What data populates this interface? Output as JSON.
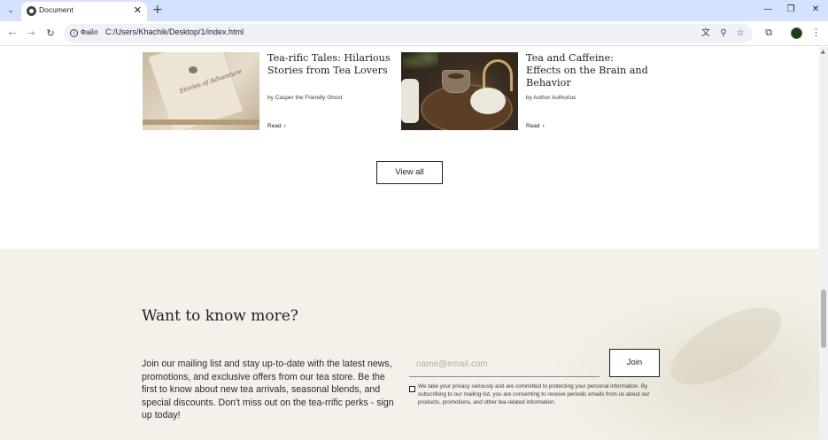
{
  "browser": {
    "tab_title": "Document",
    "site_label": "Файл",
    "url": "C:/Users/Khachik/Desktop/1/index.html",
    "icons": [
      "tab-search-icon",
      "globe-icon",
      "close-icon",
      "plus-icon",
      "minimize-icon",
      "restore-icon",
      "window-close-icon",
      "back-icon",
      "forward-icon",
      "reload-icon",
      "info-icon",
      "translate-icon",
      "zoom-icon",
      "star-icon",
      "extensions-icon",
      "profile-icon",
      "menu-icon"
    ]
  },
  "articles": [
    {
      "title": "Tea-rific Tales: Hilarious Stories from Tea Lovers",
      "author": "by Casper the Friendly Ghost",
      "read_label": "Read",
      "image_text": "Stories of Adventure"
    },
    {
      "title": "Tea and Caffeine: Effects on the Brain and Behavior",
      "author": "by Author Authorius",
      "read_label": "Read"
    }
  ],
  "view_all_label": "View all",
  "newsletter": {
    "heading": "Want to know more?",
    "body": "Join our mailing list and stay up-to-date with the latest news, promotions, and exclusive offers from our tea store. Be the first to know about new tea arrivals, seasonal blends, and special discounts. Don't miss out on the tea-rrific perks - sign up today!",
    "email_placeholder": "name@email.com",
    "join_label": "Join",
    "consent": "We take your privacy seriously and are committed to protecting your personal information. By subscribing to our mailing list, you are consenting to receive periodic emails from us about our products, promotions, and other tea-related information.",
    "colors": {
      "background": "#f5f1ea",
      "placeholder": "#b8ab98"
    }
  },
  "theme": {
    "tabbar": "#d3e3fd",
    "omnibox": "#eef1f8"
  }
}
